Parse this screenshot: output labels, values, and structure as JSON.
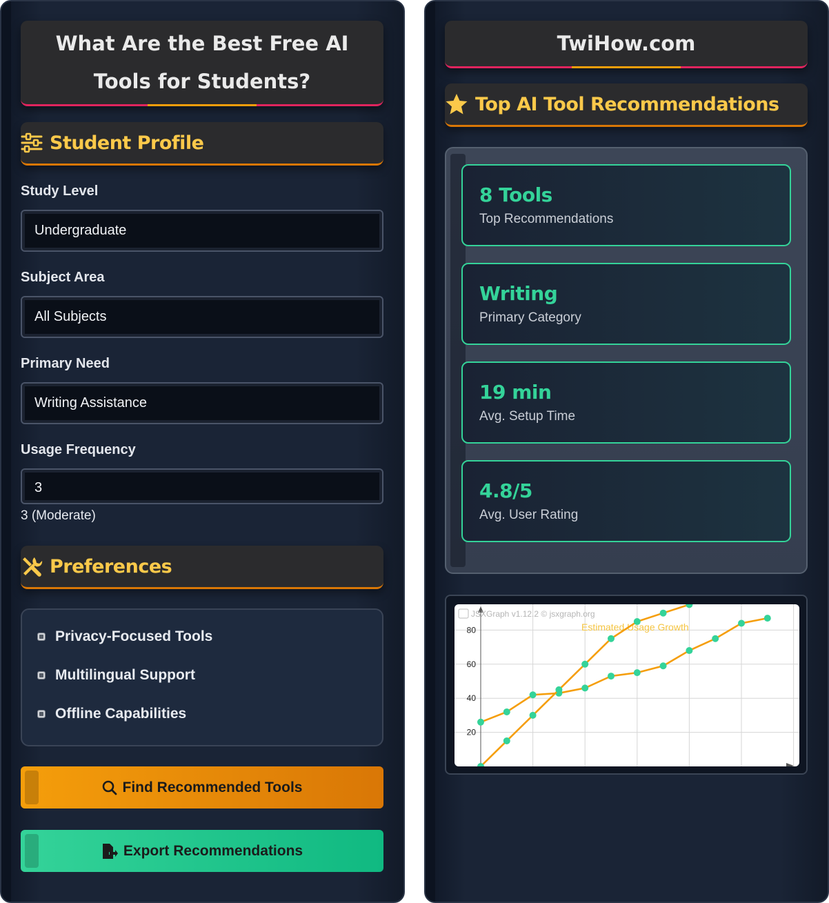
{
  "left_panel": {
    "title": "What Are the Best Free AI Tools for Students?",
    "profile_heading": "Student Profile",
    "profile_icon": "sliders-icon",
    "fields": [
      {
        "label": "Study Level",
        "value": "Undergraduate"
      },
      {
        "label": "Subject Area",
        "value": "All Subjects"
      },
      {
        "label": "Primary Need",
        "value": "Writing Assistance"
      },
      {
        "label": "Usage Frequency",
        "value": "3"
      }
    ],
    "frequency_readout": "3 (Moderate)",
    "preferences_heading": "Preferences",
    "preferences_icon": "tools-icon",
    "preferences": [
      {
        "label": "Privacy-Focused Tools",
        "checked": true
      },
      {
        "label": "Multilingual Support",
        "checked": true
      },
      {
        "label": "Offline Capabilities",
        "checked": true
      }
    ],
    "find_button": "Find Recommended Tools",
    "export_button": "Export Recommendations"
  },
  "right_panel": {
    "site_title": "TwiHow.com",
    "recommendations_heading": "Top AI Tool Recommendations",
    "recommendations_icon": "star-icon",
    "stats": [
      {
        "value": "8 Tools",
        "label": "Top Recommendations"
      },
      {
        "value": "Writing",
        "label": "Primary Category"
      },
      {
        "value": "19 min",
        "label": "Avg. Setup Time"
      },
      {
        "value": "4.8/5",
        "label": "Avg. User Rating"
      }
    ]
  },
  "colors": {
    "accent_orange": "#f59e0b",
    "accent_green": "#34d399",
    "heading_yellow": "#fbc94a",
    "title_underline_pink": "#e0245e"
  },
  "chart_data": {
    "type": "line",
    "title": "Estimated Usage Growth",
    "watermark": "JSXGraph v1.12.2 © jsxgraph.org",
    "xlabel": "",
    "ylabel": "",
    "ylim": [
      0,
      95
    ],
    "yticks": [
      20,
      40,
      60,
      80
    ],
    "grid": true,
    "series": [
      {
        "x": [
          0,
          1,
          2,
          3,
          4,
          5,
          6,
          7,
          8,
          9,
          10,
          11
        ],
        "values": [
          26,
          32,
          42,
          43,
          46,
          53,
          55,
          59,
          68,
          75,
          84,
          87
        ]
      },
      {
        "x": [
          0,
          1,
          2,
          3,
          4,
          5,
          6,
          7,
          8
        ],
        "values": [
          0,
          15,
          30,
          45,
          60,
          75,
          85,
          90,
          95
        ]
      }
    ]
  }
}
